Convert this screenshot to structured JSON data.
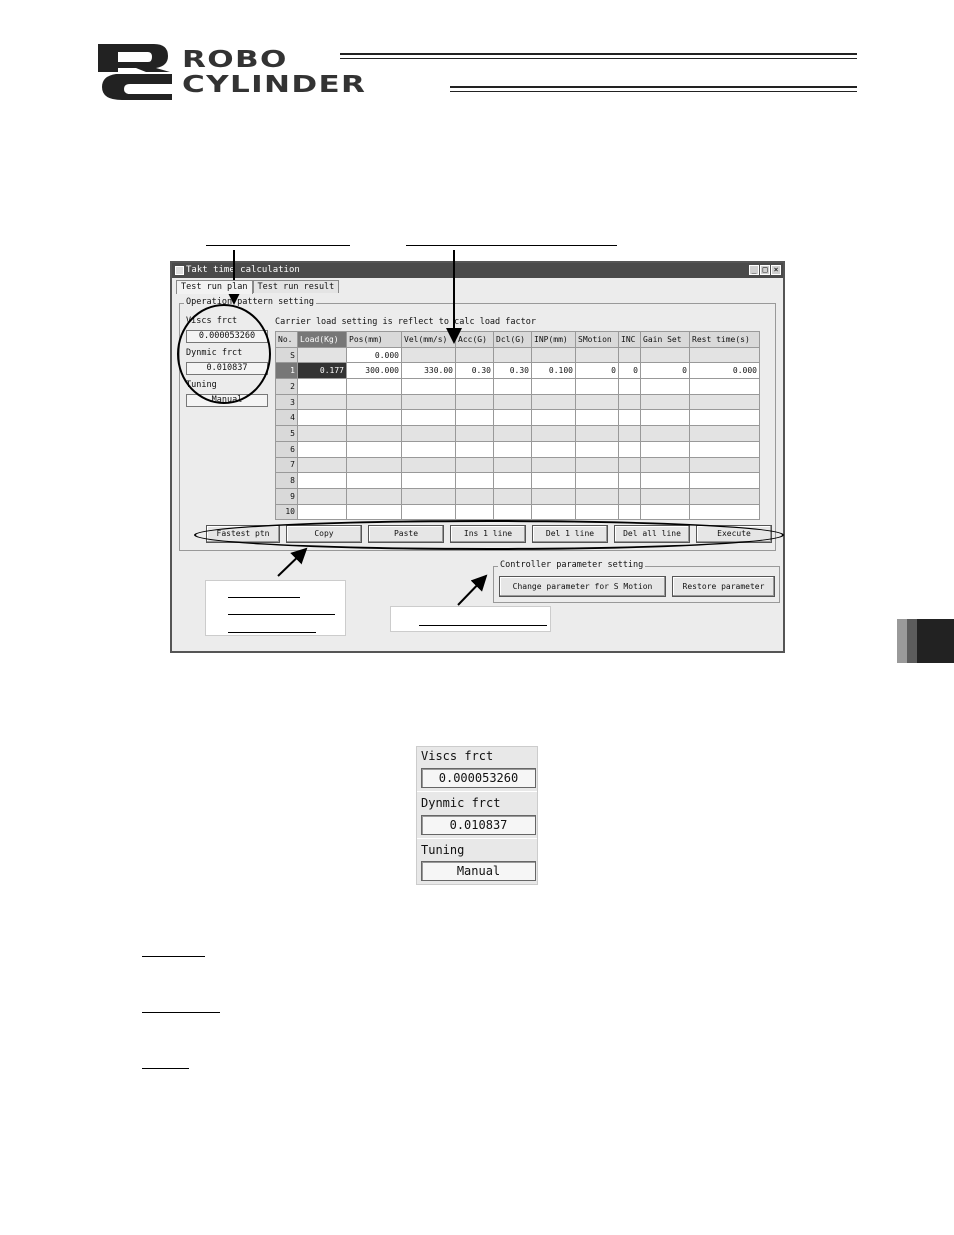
{
  "header": {
    "brand_line1": "ROBO",
    "brand_line2": "CYLINDER"
  },
  "window": {
    "title": "Takt time calculation",
    "tabs": [
      {
        "label": "Test run plan"
      },
      {
        "label": "Test run result"
      }
    ],
    "operation_group_label": "Operation pattern setting",
    "viscous_label": "Viscs frct",
    "viscous_value": "0.000053260",
    "dynamic_label": "Dynmic frct",
    "dynamic_value": "0.010837",
    "tuning_label": "Tuning",
    "tuning_value": "Manual",
    "carrier_note": "Carrier load setting is reflect to calc load factor",
    "table": {
      "columns": [
        "No.",
        "Load(Kg)",
        "Pos(mm)",
        "Vel(mm/s)",
        "Acc(G)",
        "Dcl(G)",
        "INP(mm)",
        "SMotion",
        "INC",
        "Gain Set",
        "Rest time(s)"
      ],
      "rows": [
        [
          "S",
          "",
          "0.000",
          "",
          "",
          "",
          "",
          "",
          "",
          "",
          ""
        ],
        [
          "1",
          "0.177",
          "300.000",
          "330.00",
          "0.30",
          "0.30",
          "0.100",
          "0",
          "0",
          "0",
          "0.000"
        ],
        [
          "2",
          "",
          "",
          "",
          "",
          "",
          "",
          "",
          "",
          "",
          ""
        ],
        [
          "3",
          "",
          "",
          "",
          "",
          "",
          "",
          "",
          "",
          "",
          ""
        ],
        [
          "4",
          "",
          "",
          "",
          "",
          "",
          "",
          "",
          "",
          "",
          ""
        ],
        [
          "5",
          "",
          "",
          "",
          "",
          "",
          "",
          "",
          "",
          "",
          ""
        ],
        [
          "6",
          "",
          "",
          "",
          "",
          "",
          "",
          "",
          "",
          "",
          ""
        ],
        [
          "7",
          "",
          "",
          "",
          "",
          "",
          "",
          "",
          "",
          "",
          ""
        ],
        [
          "8",
          "",
          "",
          "",
          "",
          "",
          "",
          "",
          "",
          "",
          ""
        ],
        [
          "9",
          "",
          "",
          "",
          "",
          "",
          "",
          "",
          "",
          "",
          ""
        ],
        [
          "10",
          "",
          "",
          "",
          "",
          "",
          "",
          "",
          "",
          "",
          ""
        ]
      ]
    },
    "buttons": {
      "fastest": "Fastest ptn",
      "copy": "Copy",
      "paste": "Paste",
      "ins": "Ins 1 line",
      "del": "Del 1 line",
      "delall": "Del all line",
      "execute": "Execute"
    },
    "controller_group_label": "Controller parameter setting",
    "change_param": "Change parameter for S Motion",
    "restore_param": "Restore parameter"
  },
  "zoom_panel": {
    "viscous_label": "Viscs frct",
    "viscous_value": "0.000053260",
    "dynamic_label": "Dynmic frct",
    "dynamic_value": "0.010837",
    "tuning_label": "Tuning",
    "tuning_value": "Manual"
  },
  "colors": {
    "accent_dark": "#222222",
    "window_bg": "#ececec"
  }
}
